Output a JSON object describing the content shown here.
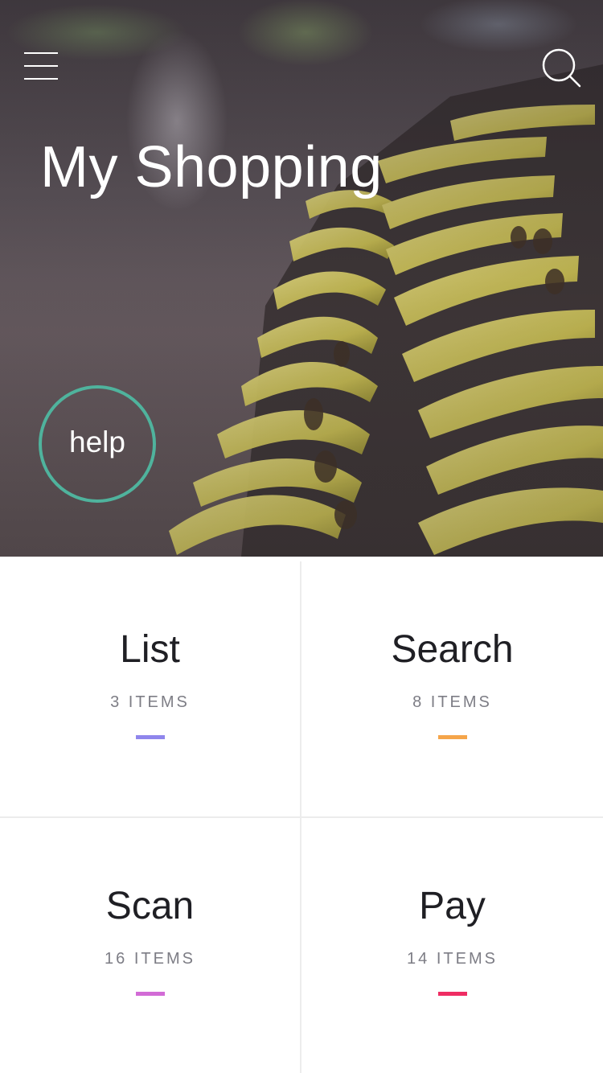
{
  "header": {
    "title": "My Shopping",
    "menu_icon": "hamburger-menu-icon",
    "search_icon": "search-icon"
  },
  "help": {
    "label": "help",
    "ring_color": "#4fb39d"
  },
  "tiles": [
    {
      "title": "List",
      "count": "3 ITEMS",
      "accent": "#8f86ec"
    },
    {
      "title": "Search",
      "count": "8 ITEMS",
      "accent": "#f5a54a"
    },
    {
      "title": "Scan",
      "count": "16 ITEMS",
      "accent": "#d26bd6"
    },
    {
      "title": "Pay",
      "count": "14 ITEMS",
      "accent": "#ef2d63"
    }
  ]
}
